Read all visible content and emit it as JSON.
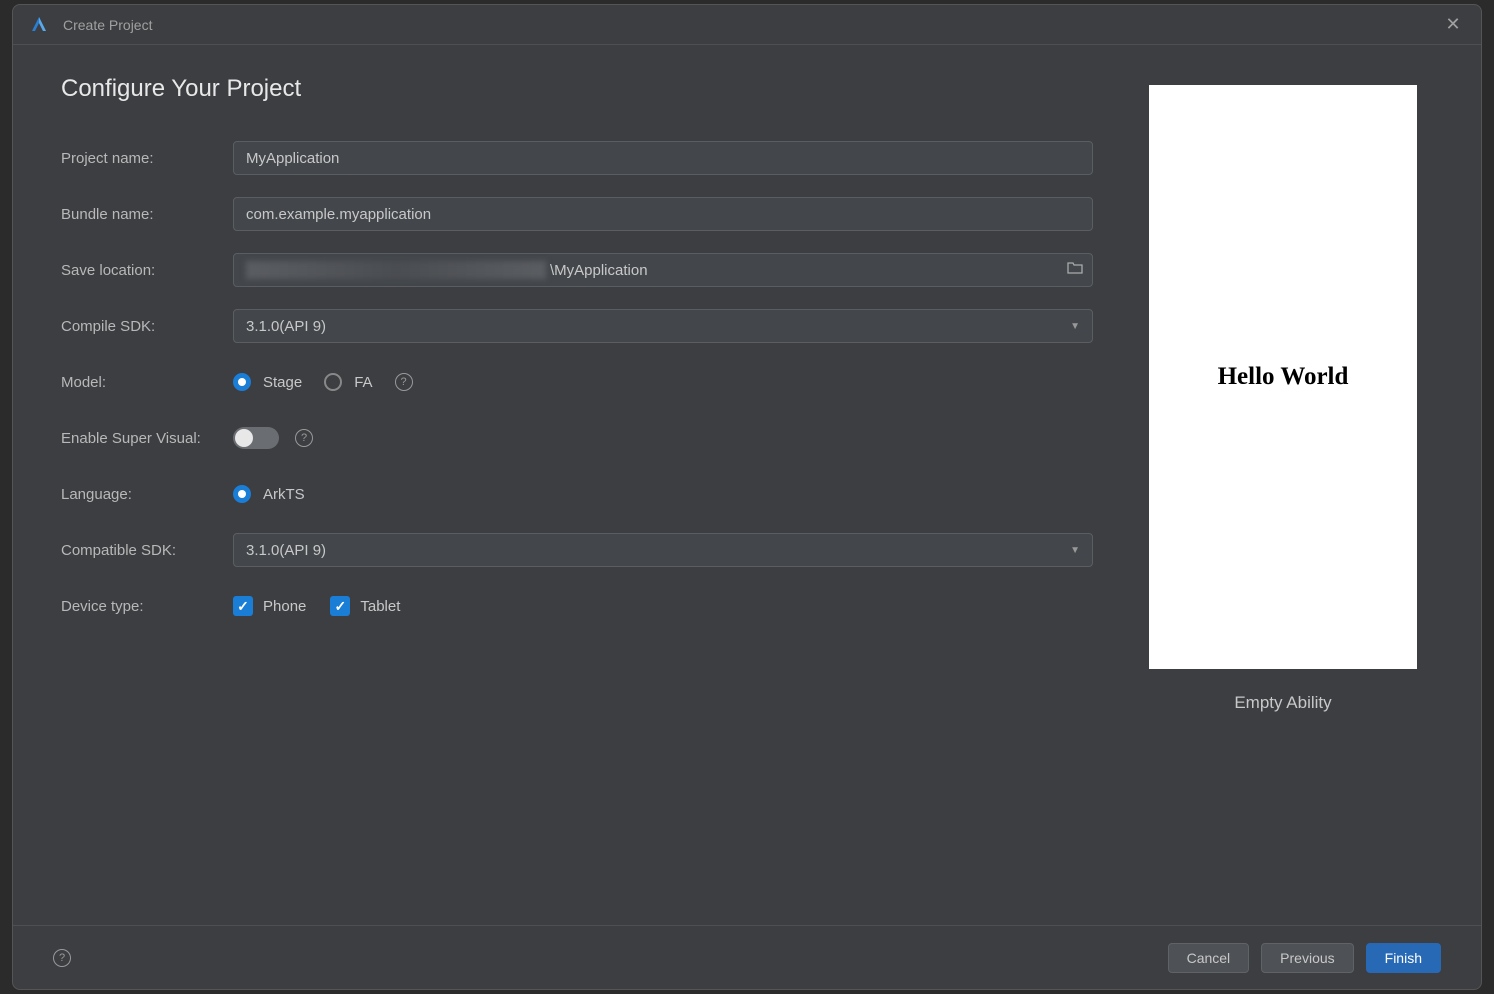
{
  "window": {
    "title": "Create Project"
  },
  "heading": "Configure Your Project",
  "labels": {
    "project_name": "Project name:",
    "bundle_name": "Bundle name:",
    "save_location": "Save location:",
    "compile_sdk": "Compile SDK:",
    "model": "Model:",
    "enable_super_visual": "Enable Super Visual:",
    "language": "Language:",
    "compatible_sdk": "Compatible SDK:",
    "device_type": "Device type:"
  },
  "values": {
    "project_name": "MyApplication",
    "bundle_name": "com.example.myapplication",
    "save_location_suffix": "\\MyApplication",
    "compile_sdk": "3.1.0(API 9)",
    "compatible_sdk": "3.1.0(API 9)"
  },
  "model_options": {
    "stage": "Stage",
    "fa": "FA"
  },
  "language_options": {
    "arkts": "ArkTS"
  },
  "device_options": {
    "phone": "Phone",
    "tablet": "Tablet"
  },
  "preview": {
    "text": "Hello World",
    "caption": "Empty Ability"
  },
  "buttons": {
    "cancel": "Cancel",
    "previous": "Previous",
    "finish": "Finish"
  }
}
